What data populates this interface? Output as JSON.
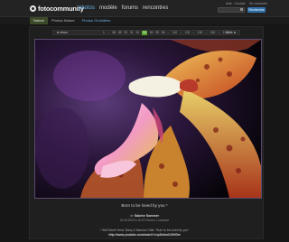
{
  "header": {
    "logo_text": "fotocommunity",
    "nav": [
      "photos",
      "modèle",
      "forums",
      "rencontres"
    ],
    "active_nav": "photos",
    "util_links": [
      "Aide · Contact",
      "Se connecter"
    ],
    "search_button": "Recherche"
  },
  "subnav": {
    "items": [
      "Nature",
      "Photos Nature",
      "Photos Orchidées"
    ],
    "active": "Photos Orchidées"
  },
  "pager": {
    "prev": "◄ retour",
    "next": "suite ►",
    "pages": [
      "1",
      "...",
      "88",
      "89",
      "90",
      "91",
      "92",
      "93",
      "94",
      "95",
      "96",
      "...",
      "110",
      "...",
      "120",
      "...",
      "130",
      "...",
      "140",
      "...",
      "1293"
    ],
    "current": "93"
  },
  "photo": {
    "title": "Born to be loved by you *",
    "author_prefix": "de",
    "author": "Sabine Sommer",
    "date": "16.08.2009 à 16:19 Heures, Lousanne",
    "description": "* Well Worth Hear; Barry & Maurice Gibb: \"Born to be loved by you\"",
    "link": "http://www.youtube.com/watch?v=p2b4wd/JOHGw"
  },
  "colors": {
    "link_blue": "#6ab3e8",
    "page_current": "#58a62c",
    "search_button": "#2f6fa8"
  }
}
